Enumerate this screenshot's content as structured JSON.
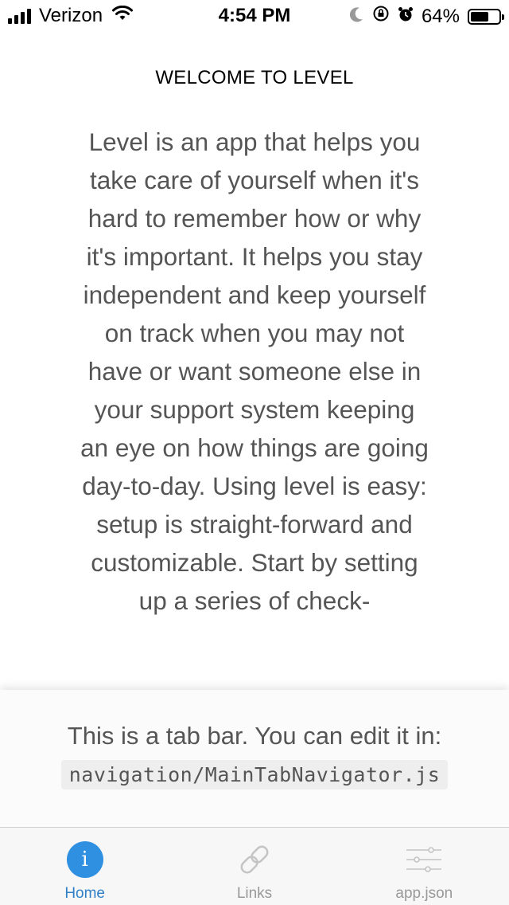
{
  "status_bar": {
    "carrier": "Verizon",
    "time": "4:54 PM",
    "battery_percent": "64%",
    "battery_level": 0.64,
    "icons": [
      "signal-icon",
      "wifi-icon",
      "moon-icon",
      "orientation-lock-icon",
      "alarm-icon",
      "battery-icon"
    ]
  },
  "screen": {
    "title": "WELCOME TO LEVEL",
    "body": "Level is an app that helps you take care of yourself when it's hard to remember how or why it's important. It helps you stay independent and keep yourself on track when you may not have or want someone else in your support system keeping an eye on how things are going day-to-day. Using level is easy: setup is straight-forward and customizable. Start by setting up a series of check-"
  },
  "tab_info": {
    "text": "This is a tab bar. You can edit it in:",
    "path": "navigation/MainTabNavigator.js"
  },
  "tabs": [
    {
      "label": "Home",
      "icon": "info-icon",
      "active": true
    },
    {
      "label": "Links",
      "icon": "link-icon",
      "active": false
    },
    {
      "label": "app.json",
      "icon": "options-icon",
      "active": false
    }
  ],
  "colors": {
    "accent": "#2f80c8",
    "icon_blue": "#2f8fe0",
    "inactive": "#999999",
    "body_text": "#555555"
  }
}
